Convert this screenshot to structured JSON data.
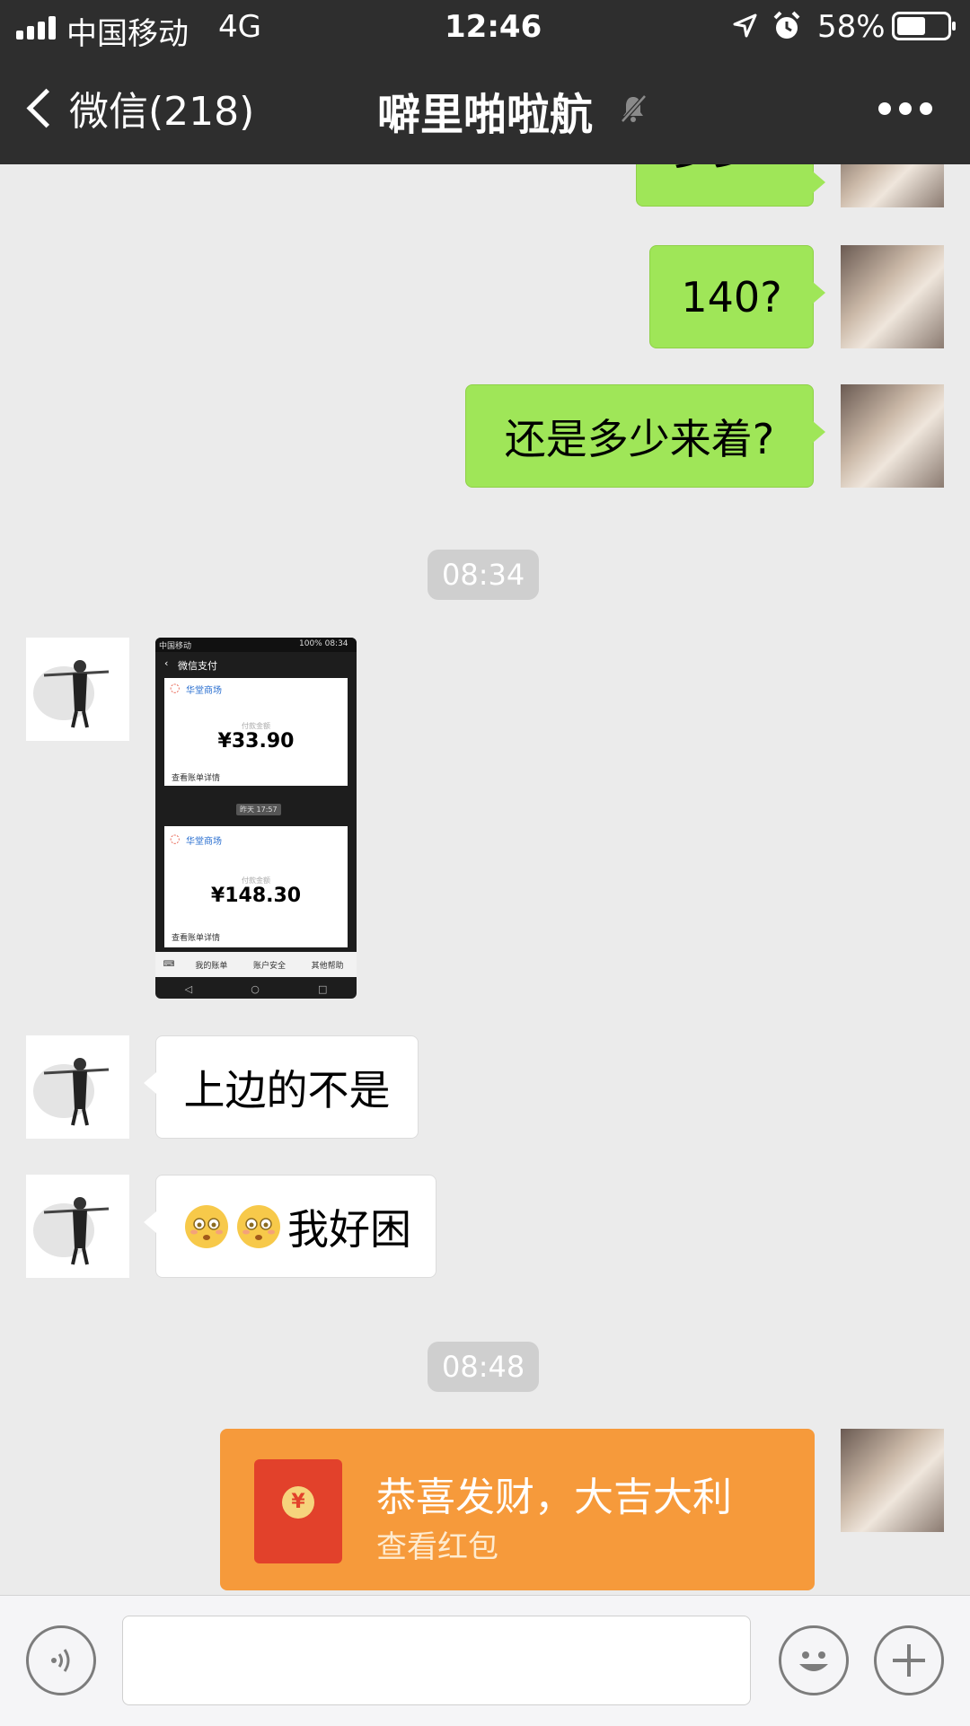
{
  "status_bar": {
    "carrier": "中国移动",
    "network": "4G",
    "time": "12:46",
    "battery_percent": "58%",
    "battery_level": 0.58
  },
  "nav": {
    "back_label": "微信(218)",
    "title": "噼里啪啦航"
  },
  "messages": [
    {
      "side": "me",
      "text": "多少?"
    },
    {
      "side": "me",
      "text": "140?"
    },
    {
      "side": "me",
      "text": "还是多少来着?"
    },
    {
      "time": "08:34"
    },
    {
      "side": "other",
      "type": "image",
      "screenshot": {
        "status": "中国移动",
        "status_right": "100% 08:34",
        "title": "微信支付",
        "cards": [
          {
            "merchant": "华堂商场",
            "label": "付款金额",
            "amount": "¥33.90",
            "link": "查看账单详情"
          },
          {
            "merchant": "华堂商场",
            "label": "付款金额",
            "amount": "¥148.30",
            "link": "查看账单详情"
          }
        ],
        "date_chip": "昨天 17:57",
        "menu": [
          "我的账单",
          "账户安全",
          "其他帮助"
        ]
      }
    },
    {
      "side": "other",
      "text": "上边的不是"
    },
    {
      "side": "other",
      "text": "我好困",
      "emoji_icon": "sleepy-face-icon"
    },
    {
      "time": "08:48"
    },
    {
      "side": "me",
      "type": "red_packet",
      "title": "恭喜发财，大吉大利",
      "subtitle": "查看红包"
    }
  ],
  "colors": {
    "nav_bg": "#2e2e2e",
    "bubble_me": "#9fe658",
    "red_packet": "#f69a3b"
  }
}
